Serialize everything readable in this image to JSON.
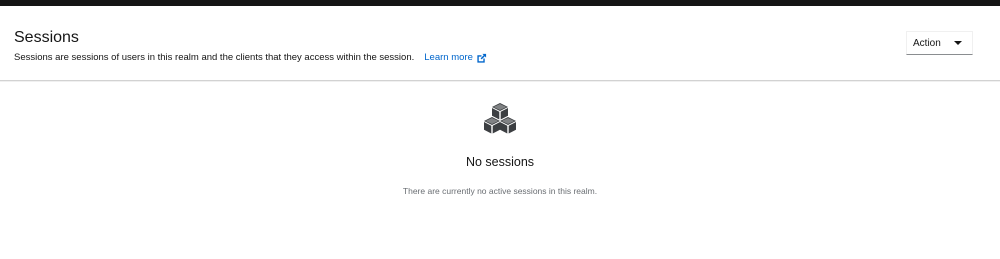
{
  "header": {
    "title": "Sessions",
    "description": "Sessions are sessions of users in this realm and the clients that they access within the session.",
    "learn_more": "Learn more",
    "action_label": "Action"
  },
  "empty_state": {
    "icon": "cubes-icon",
    "title": "No sessions",
    "message": "There are currently no active sessions in this realm."
  },
  "colors": {
    "link": "#0066cc",
    "topbar": "#151515",
    "muted_text": "#6a6e73"
  }
}
